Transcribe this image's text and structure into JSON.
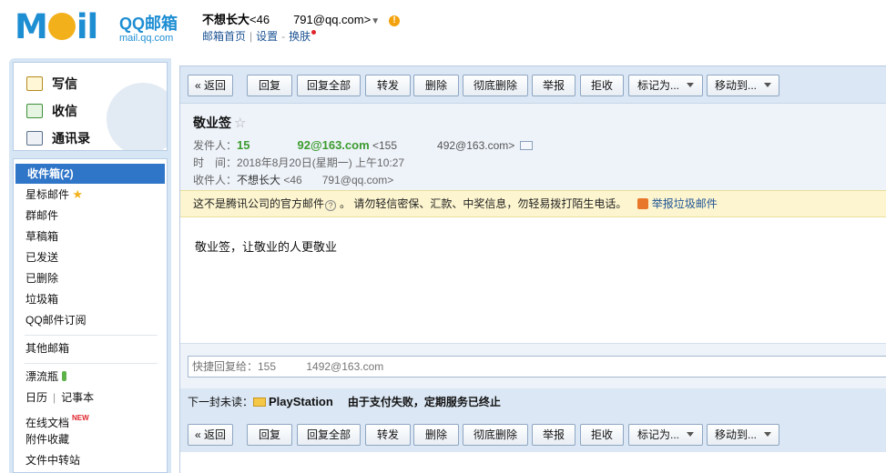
{
  "logo": {
    "moil": "MOil",
    "product": "QQ邮箱",
    "domain": "mail.qq.com"
  },
  "account": {
    "nickname": "不想长大",
    "email_left": "<46",
    "email_right": "791@qq.com>",
    "caret": "▼",
    "warn": "!"
  },
  "toplinks": [
    "邮箱首页",
    "设置",
    "换肤"
  ],
  "quick": [
    "写信",
    "收信",
    "通讯录"
  ],
  "folders": {
    "inbox": "收件箱(2)",
    "starred": "星标邮件",
    "group": "群邮件",
    "drafts": "草稿箱",
    "sent": "已发送",
    "deleted": "已删除",
    "spam": "垃圾箱",
    "subscribe": "QQ邮件订阅",
    "other": "其他邮箱",
    "bottle": "漂流瓶",
    "calendar": "日历",
    "notes": "记事本",
    "docs": "在线文档",
    "docs_badge": "NEW",
    "attachments": "附件收藏",
    "transfer": "文件中转站"
  },
  "toolbar": {
    "back": "« 返回",
    "reply": "回复",
    "reply_all": "回复全部",
    "forward": "转发",
    "delete": "删除",
    "delete_forever": "彻底删除",
    "report": "举报",
    "reject": "拒收",
    "mark_as": "标记为...",
    "move_to": "移动到..."
  },
  "mail": {
    "subject": "敬业签",
    "from_label": "发件人：",
    "from_name_left": "15",
    "from_name_right": "92@163.com",
    "from_addr_left": "<155",
    "from_addr_right": "492@163.com>",
    "time_label": "时　间：",
    "time": "2018年8月20日(星期一) 上午10:27",
    "to_label": "收件人：",
    "to_name": "不想长大",
    "to_addr_left": "<46",
    "to_addr_right": "791@qq.com>",
    "notice": "这不是腾讯公司的官方邮件",
    "notice_tip": "。 请勿轻信密保、汇款、中奖信息，勿轻易拨打陌生电话。",
    "report_spam": "举报垃圾邮件",
    "body": "敬业签，让敬业的人更敬业"
  },
  "reply": {
    "placeholder": "快捷回复给：155          1492@163.com"
  },
  "next": {
    "label": "下一封未读：",
    "sender": "PlayStation",
    "subject": "由于支付失败，定期服务已终止"
  }
}
